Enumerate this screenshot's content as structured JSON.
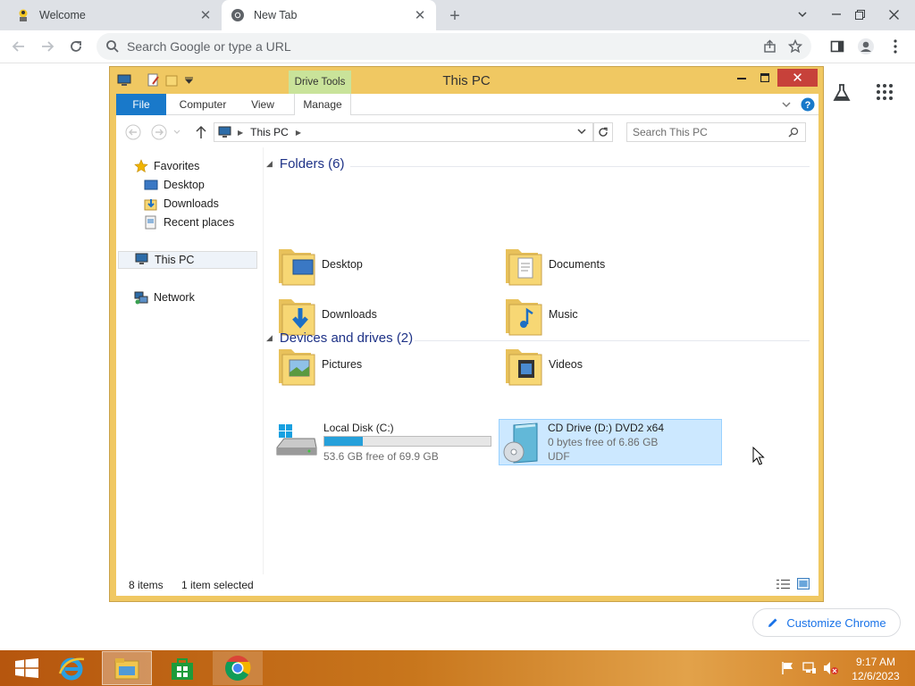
{
  "browser": {
    "tabs": [
      {
        "title": "Welcome",
        "active": false
      },
      {
        "title": "New Tab",
        "active": true
      }
    ],
    "omnibox_placeholder": "Search Google or type a URL",
    "customize_label": "Customize Chrome"
  },
  "explorer": {
    "title": "This PC",
    "contextual_tab": "Drive Tools",
    "ribbon_tabs": [
      "File",
      "Computer",
      "View",
      "Manage"
    ],
    "address": "This PC",
    "search_placeholder": "Search This PC",
    "nav": {
      "favorites": "Favorites",
      "favorite_items": [
        "Desktop",
        "Downloads",
        "Recent places"
      ],
      "this_pc": "This PC",
      "network": "Network"
    },
    "folders_header": "Folders (6)",
    "folders": [
      "Desktop",
      "Documents",
      "Downloads",
      "Music",
      "Pictures",
      "Videos"
    ],
    "devices_header": "Devices and drives (2)",
    "drives": [
      {
        "name": "Local Disk (C:)",
        "free_text": "53.6 GB free of 69.9 GB",
        "used_fraction": 0.233
      },
      {
        "name": "CD Drive (D:) DVD2 x64",
        "free_text": "0 bytes free of 6.86 GB",
        "fs": "UDF",
        "selected": true
      }
    ],
    "status_items": "8 items",
    "status_selected": "1 item selected"
  },
  "taskbar": {
    "time": "9:17 AM",
    "date": "12/6/2023"
  },
  "colors": {
    "explorer_frame": "#f0c862",
    "accent_blue": "#1979ca",
    "close_red": "#c7413a",
    "selection": "#cce8ff",
    "taskbar": "#c8761c"
  }
}
